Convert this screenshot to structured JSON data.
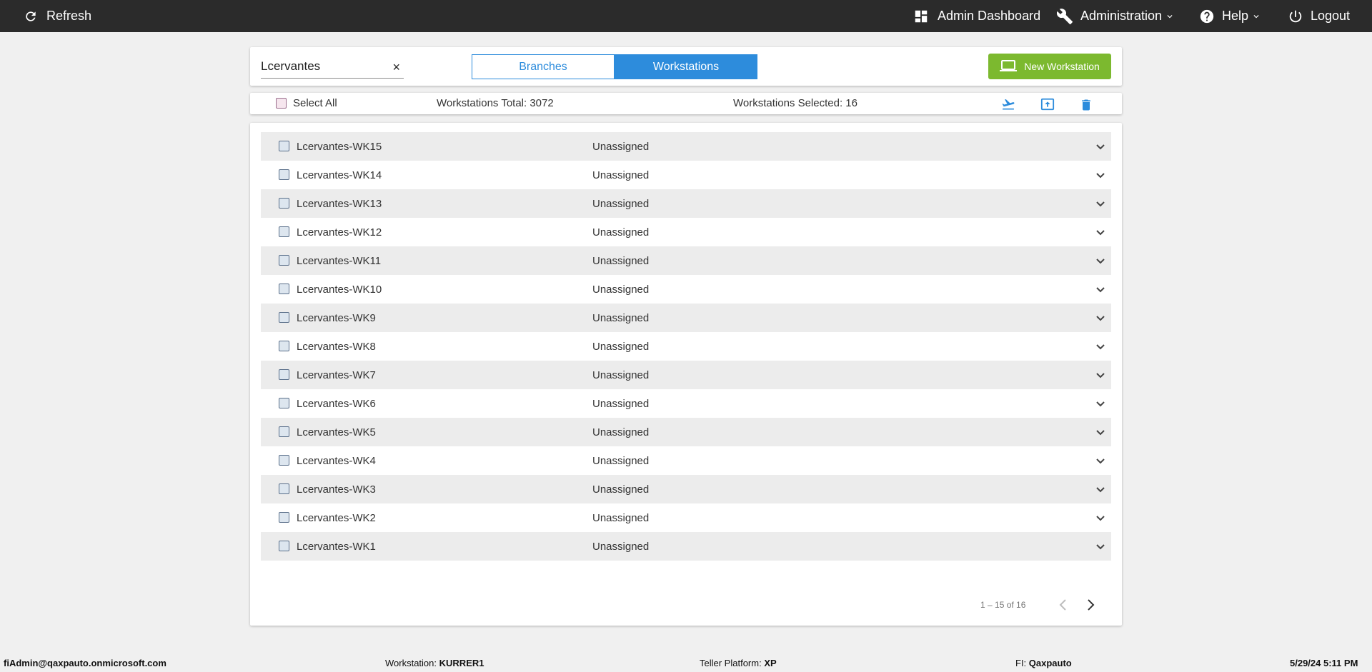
{
  "topbar": {
    "refresh_label": "Refresh",
    "admin_dashboard_label": "Admin Dashboard",
    "administration_label": "Administration",
    "help_label": "Help",
    "logout_label": "Logout",
    "background": "#2b2b2b"
  },
  "search": {
    "value": "Lcervantes",
    "clear_symbol": "×"
  },
  "tabs": {
    "branches": "Branches",
    "workstations": "Workstations",
    "active": "Workstations",
    "accent": "#2d8cdc"
  },
  "new_workstation": {
    "label": "New Workstation",
    "color": "#7cb92f"
  },
  "toolbar": {
    "select_all": "Select All",
    "total": "Workstations Total: 3072",
    "selected": "Workstations Selected: 16",
    "icons": [
      "plane-icon",
      "upload-icon",
      "trash-icon"
    ]
  },
  "rows": [
    {
      "name": "Lcervantes-WK15",
      "status": "Unassigned"
    },
    {
      "name": "Lcervantes-WK14",
      "status": "Unassigned"
    },
    {
      "name": "Lcervantes-WK13",
      "status": "Unassigned"
    },
    {
      "name": "Lcervantes-WK12",
      "status": "Unassigned"
    },
    {
      "name": "Lcervantes-WK11",
      "status": "Unassigned"
    },
    {
      "name": "Lcervantes-WK10",
      "status": "Unassigned"
    },
    {
      "name": "Lcervantes-WK9",
      "status": "Unassigned"
    },
    {
      "name": "Lcervantes-WK8",
      "status": "Unassigned"
    },
    {
      "name": "Lcervantes-WK7",
      "status": "Unassigned"
    },
    {
      "name": "Lcervantes-WK6",
      "status": "Unassigned"
    },
    {
      "name": "Lcervantes-WK5",
      "status": "Unassigned"
    },
    {
      "name": "Lcervantes-WK4",
      "status": "Unassigned"
    },
    {
      "name": "Lcervantes-WK3",
      "status": "Unassigned"
    },
    {
      "name": "Lcervantes-WK2",
      "status": "Unassigned"
    },
    {
      "name": "Lcervantes-WK1",
      "status": "Unassigned"
    }
  ],
  "pagination": {
    "range": "1 – 15 of 16"
  },
  "footer": {
    "user": "fiAdmin@qaxpauto.onmicrosoft.com",
    "workstation_label": "Workstation:",
    "workstation_value": "KURRER1",
    "platform_label": "Teller Platform:",
    "platform_value": "XP",
    "fi_label": "FI:",
    "fi_value": "Qaxpauto",
    "datetime": "5/29/24 5:11 PM"
  }
}
